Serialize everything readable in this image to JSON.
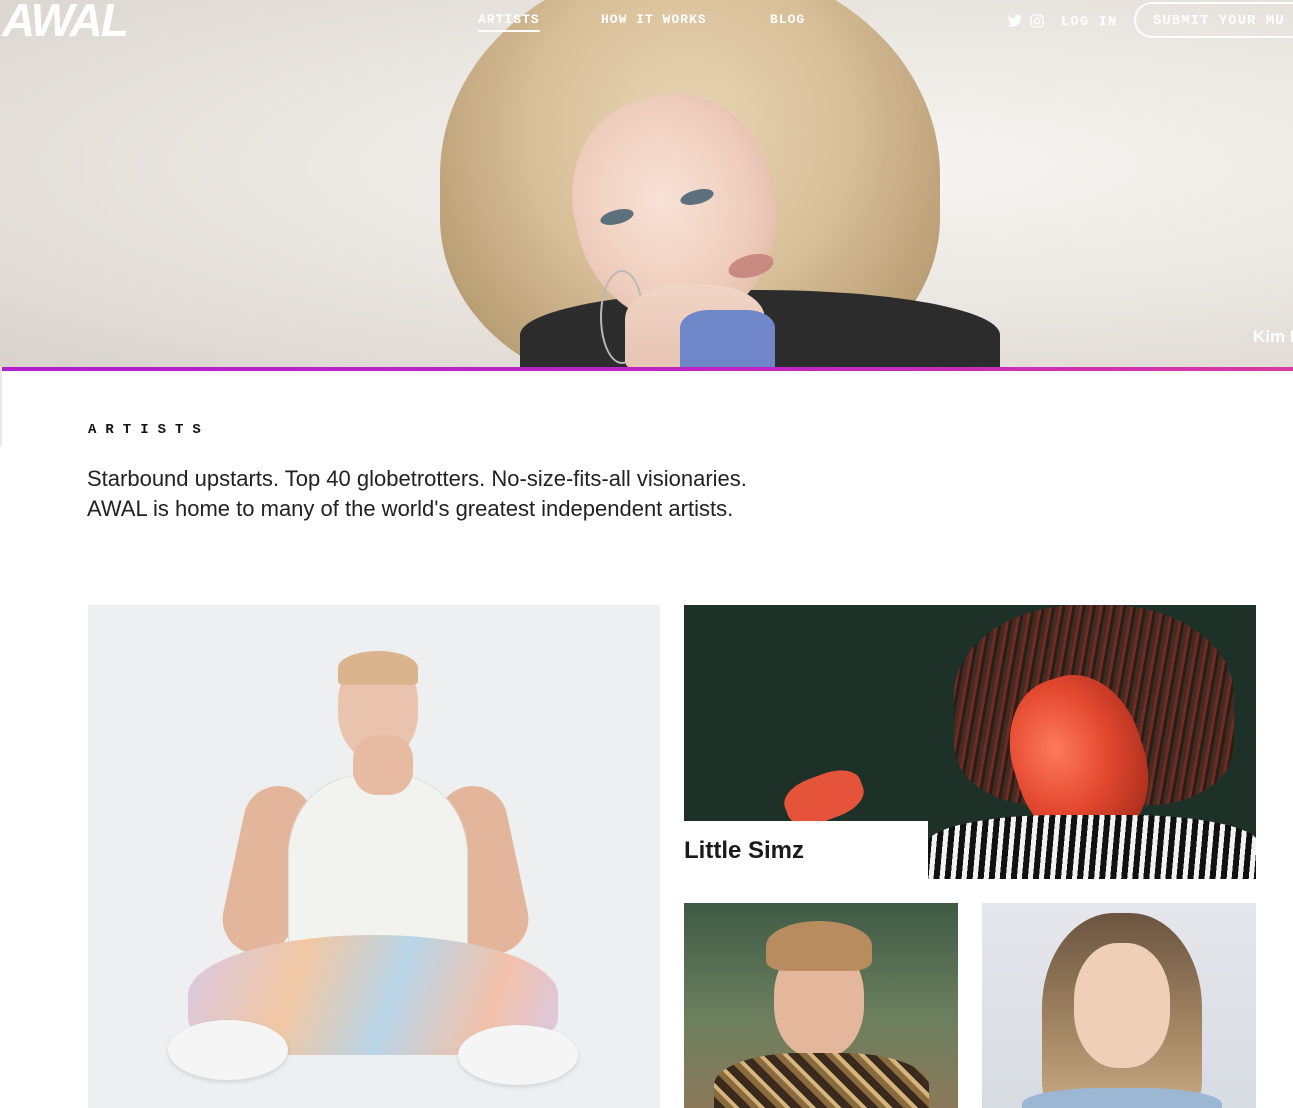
{
  "header": {
    "logo_text": "AWAL",
    "nav": [
      {
        "label": "ARTISTS",
        "active": true
      },
      {
        "label": "HOW IT WORKS",
        "active": false
      },
      {
        "label": "BLOG",
        "active": false
      }
    ],
    "social_icons": [
      "twitter-icon",
      "instagram-icon"
    ],
    "login_label": "LOG IN",
    "submit_label": "SUBMIT YOUR MU"
  },
  "hero": {
    "caption": "Kim P"
  },
  "colors": {
    "accent_bar": "#b11fcf",
    "nav_text": "#ffffff"
  },
  "artists_section": {
    "heading": "ARTISTS",
    "intro_line1": "Starbound upstarts. Top 40 globetrotters. No-size-fits-all visionaries.",
    "intro_line2": "AWAL is home to many of the world's greatest independent artists."
  },
  "grid": {
    "cards": [
      {
        "name": ""
      },
      {
        "name": "Little Simz"
      },
      {
        "name": ""
      },
      {
        "name": ""
      }
    ]
  }
}
